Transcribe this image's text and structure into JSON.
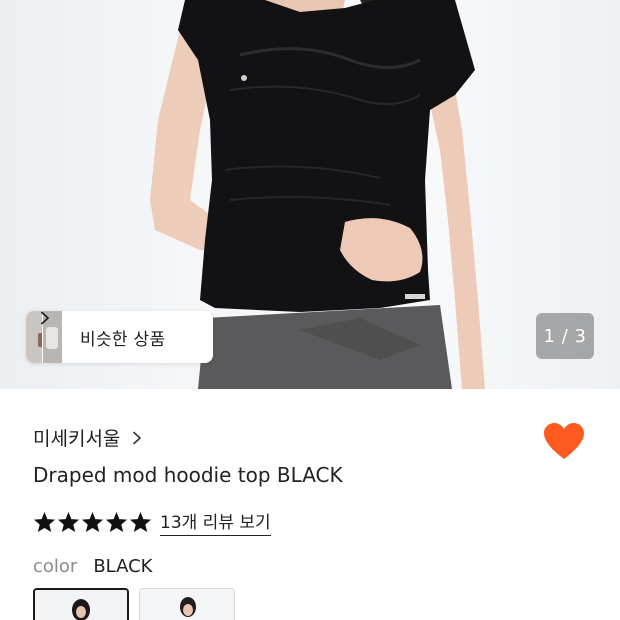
{
  "gallery": {
    "counter": "1 / 3",
    "similar_label": "비슷한 상품"
  },
  "product": {
    "brand": "미세키서울",
    "title": "Draped mod hoodie top BLACK",
    "rating_stars": 5,
    "review_link": "13개 리뷰 보기",
    "wishlisted": true,
    "color_label": "color",
    "color_value": "BLACK"
  },
  "colors": {
    "heart": "#FF5A1F",
    "text": "#222222",
    "muted": "#8C8C8C"
  }
}
